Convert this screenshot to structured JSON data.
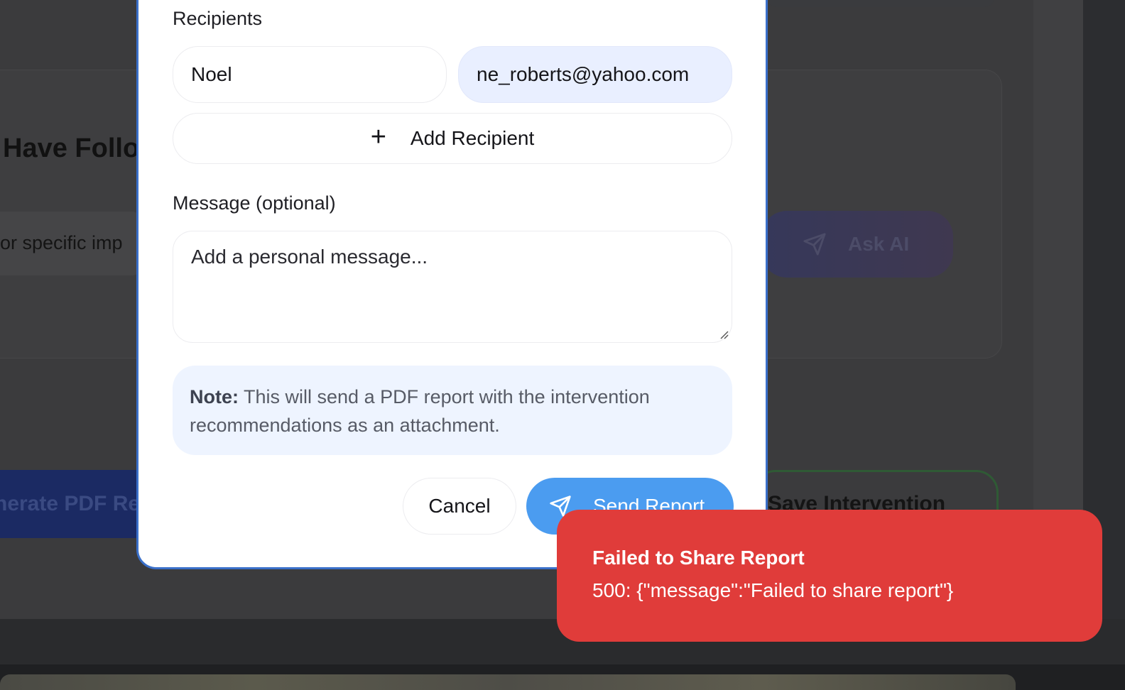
{
  "background": {
    "heading": "Have Follo",
    "input_fragment": "or specific imp",
    "ask_ai_label": "Ask AI",
    "generate_pdf_label": "nerate PDF Re",
    "save_intervention_label": "Save Intervention"
  },
  "modal": {
    "recipients_label": "Recipients",
    "recipient_name_value": "Noel",
    "recipient_email_value": "ne_roberts@yahoo.com",
    "add_recipient_label": "Add Recipient",
    "add_recipient_icon": "plus-icon",
    "message_label": "Message (optional)",
    "message_placeholder": "Add a personal message...",
    "note_bold": "Note:",
    "note_text": " This will send a PDF report with the intervention recommendations as an attachment.",
    "cancel_label": "Cancel",
    "send_label": "Send Report",
    "send_icon": "send-icon",
    "accent_color": "#4b9cf0"
  },
  "toast": {
    "title": "Failed to Share Report",
    "message": "500: {\"message\":\"Failed to share report\"}",
    "color": "#e03c3a"
  }
}
